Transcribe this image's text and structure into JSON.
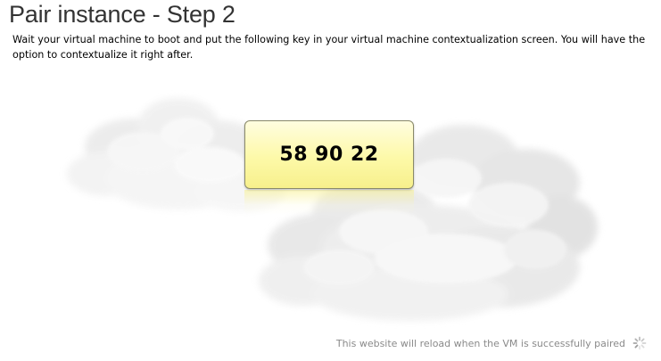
{
  "page": {
    "title": "Pair instance - Step 2",
    "instructions": "Wait your virtual machine to boot and put the following key in your virtual machine contextualization screen. You will have the option to contextualize it right after."
  },
  "pairing": {
    "key": "58 90 22"
  },
  "status": {
    "message": "This website will reload when the VM is successfully paired",
    "icon": "loading-spinner-icon"
  },
  "colors": {
    "key_box_top": "#fffde0",
    "key_box_bottom": "#f7f08c",
    "status_text": "#8a8a8a"
  }
}
